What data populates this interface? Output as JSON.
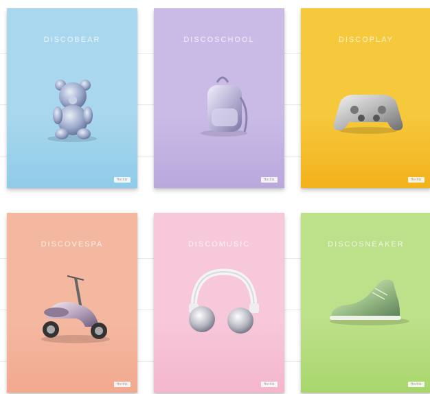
{
  "notebooks": [
    {
      "title": "DISCOBEAR",
      "object": "bear-icon",
      "colors": {
        "top": "#a9d7ee",
        "bottom": "#8fcbe8"
      }
    },
    {
      "title": "DISCOSCHOOL",
      "object": "backpack-icon",
      "colors": {
        "top": "#c9bbe6",
        "bottom": "#b9a8dc"
      }
    },
    {
      "title": "DISCOPLAY",
      "object": "gamepad-icon",
      "colors": {
        "top": "#f6c83c",
        "bottom": "#f2b21b"
      }
    },
    {
      "title": "DISCOVESPA",
      "object": "scooter-icon",
      "colors": {
        "top": "#f4b8a0",
        "bottom": "#f2a98f"
      }
    },
    {
      "title": "DISCOMUSIC",
      "object": "headphones-icon",
      "colors": {
        "top": "#f7c8da",
        "bottom": "#f4b6cd"
      }
    },
    {
      "title": "DISCOSNEAKER",
      "object": "sneaker-icon",
      "colors": {
        "top": "#bde08a",
        "bottom": "#a8d66b"
      }
    }
  ],
  "brand_label": "Herlitz"
}
